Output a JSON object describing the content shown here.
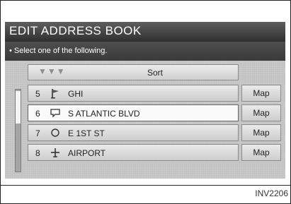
{
  "screen": {
    "title": "EDIT ADDRESS BOOK",
    "instruction": "• Select one of the following.",
    "sort": {
      "arrows": "▼▼▼",
      "label": "Sort"
    },
    "rows": [
      {
        "number": "5",
        "icon": "flag-icon",
        "name": "GHI",
        "map_label": "Map",
        "highlighted": false
      },
      {
        "number": "6",
        "icon": "talk-bubble-icon",
        "name": "S ATLANTIC BLVD",
        "map_label": "Map",
        "highlighted": true
      },
      {
        "number": "7",
        "icon": "circle-icon",
        "name": "E 1ST ST",
        "map_label": "Map",
        "highlighted": false
      },
      {
        "number": "8",
        "icon": "airplane-icon",
        "name": "AIRPORT",
        "map_label": "Map",
        "highlighted": false
      }
    ]
  },
  "caption": "INV2206",
  "colors": {
    "title_bar": "#3a3a3a",
    "panel": "#c9c9c9",
    "highlight_row": "#fafafa"
  }
}
